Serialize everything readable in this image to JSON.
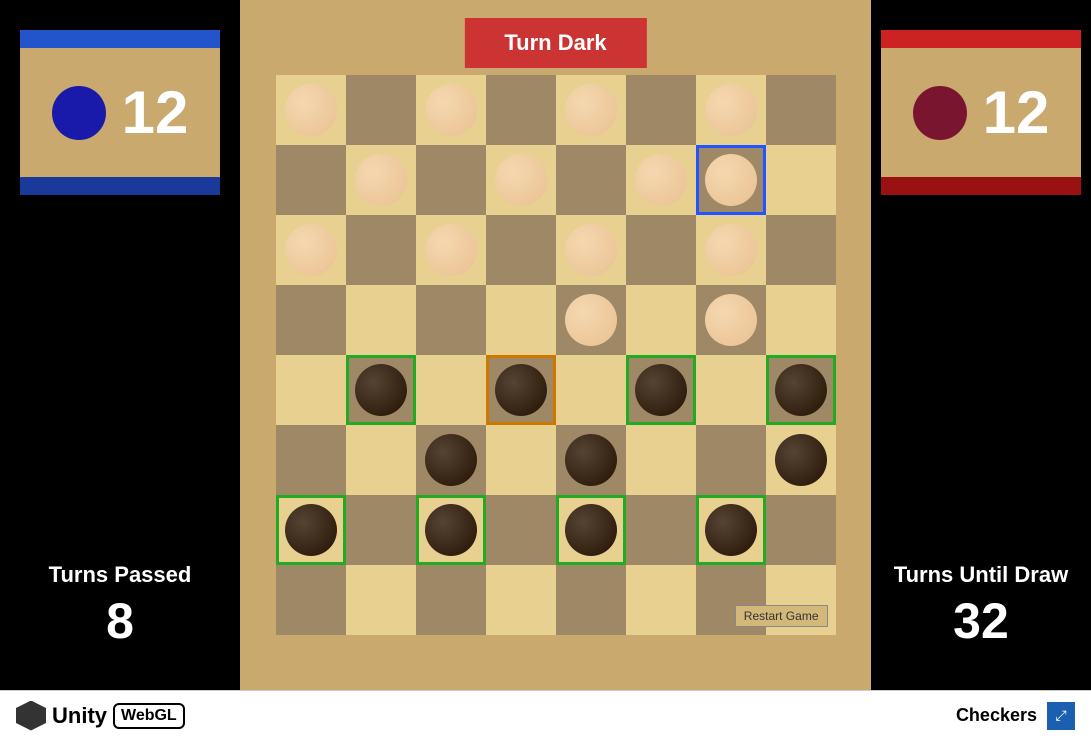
{
  "game": {
    "title": "Checkers",
    "turn_label": "Turn Dark",
    "turns_passed_label": "Turns Passed",
    "turns_passed_value": "8",
    "turns_until_draw_label": "Turns Until Draw",
    "turns_until_draw_value": "32",
    "light_score": "12",
    "dark_score": "12",
    "restart_button": "Restart Game"
  },
  "footer": {
    "unity_label": "Unity",
    "webgl_label": "WebGL",
    "checkers_label": "Checkers",
    "fullscreen_icon": "⤢"
  },
  "board": {
    "rows": 8,
    "cols": 8
  }
}
